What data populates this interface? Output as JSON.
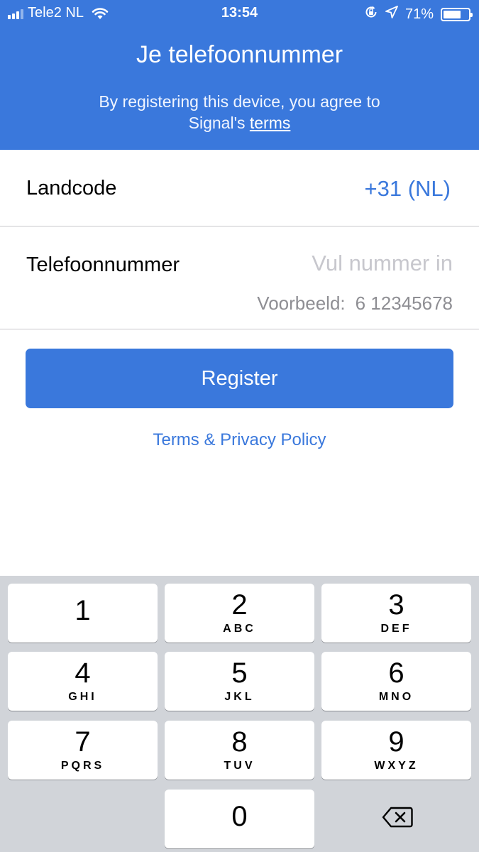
{
  "status_bar": {
    "carrier": "Tele2 NL",
    "time": "13:54",
    "battery": "71%",
    "battery_level": 0.71
  },
  "header": {
    "title": "Je telefoonnummer",
    "subtitle_line1": "By registering this device, you agree to",
    "subtitle_prefix": "Signal's ",
    "terms_link": "terms",
    "background_color": "#3a78dc"
  },
  "country": {
    "label": "Landcode",
    "value": "+31 (NL)"
  },
  "phone": {
    "label": "Telefoonnummer",
    "value": "",
    "placeholder": "Vul nummer in",
    "example_label": "Voorbeeld:",
    "example_number": "6 12345678"
  },
  "actions": {
    "register_label": "Register",
    "privacy_link": "Terms & Privacy Policy",
    "accent_color": "#3a78dc"
  },
  "keypad": {
    "keys": [
      {
        "digit": "1",
        "letters": ""
      },
      {
        "digit": "2",
        "letters": "ABC"
      },
      {
        "digit": "3",
        "letters": "DEF"
      },
      {
        "digit": "4",
        "letters": "GHI"
      },
      {
        "digit": "5",
        "letters": "JKL"
      },
      {
        "digit": "6",
        "letters": "MNO"
      },
      {
        "digit": "7",
        "letters": "PQRS"
      },
      {
        "digit": "8",
        "letters": "TUV"
      },
      {
        "digit": "9",
        "letters": "WXYZ"
      },
      {
        "digit": "0",
        "letters": ""
      }
    ],
    "delete_icon": "backspace-icon"
  }
}
